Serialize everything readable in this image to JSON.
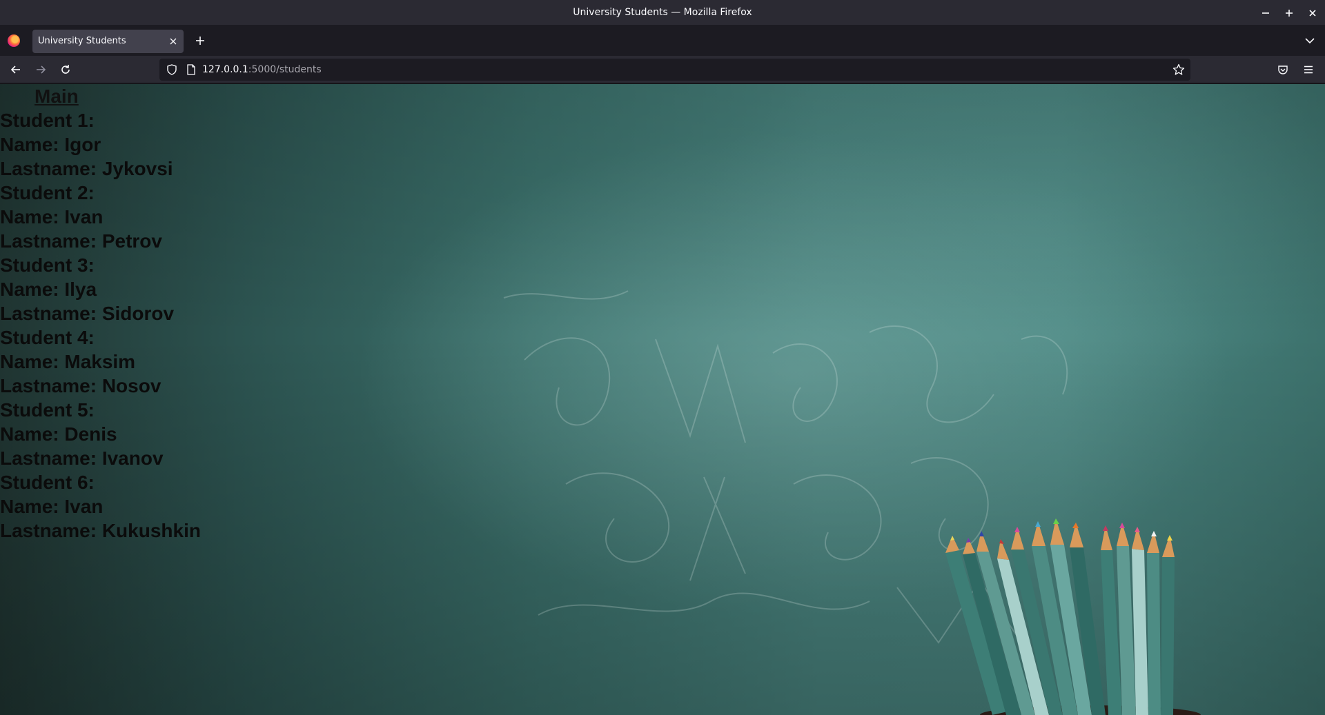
{
  "window": {
    "title": "University Students — Mozilla Firefox"
  },
  "tabs": [
    {
      "label": "University Students"
    }
  ],
  "urlbar": {
    "host": "127.0.0.1",
    "path": ":5000/students"
  },
  "page": {
    "nav_link": "Main",
    "students": [
      {
        "heading": "Student 1:",
        "name": "Name: Igor",
        "lastname": "Lastname: Jykovsi"
      },
      {
        "heading": "Student 2:",
        "name": "Name: Ivan",
        "lastname": "Lastname: Petrov"
      },
      {
        "heading": "Student 3:",
        "name": "Name: Ilya",
        "lastname": "Lastname: Sidorov"
      },
      {
        "heading": "Student 4:",
        "name": "Name: Maksim",
        "lastname": "Lastname: Nosov"
      },
      {
        "heading": "Student 5:",
        "name": "Name: Denis",
        "lastname": "Lastname: Ivanov"
      },
      {
        "heading": "Student 6:",
        "name": "Name: Ivan",
        "lastname": "Lastname: Kukushkin"
      }
    ]
  },
  "colors": {
    "chrome_bg": "#2b2a33",
    "tab_active": "#42414d",
    "chalkboard": "#4a8580"
  }
}
